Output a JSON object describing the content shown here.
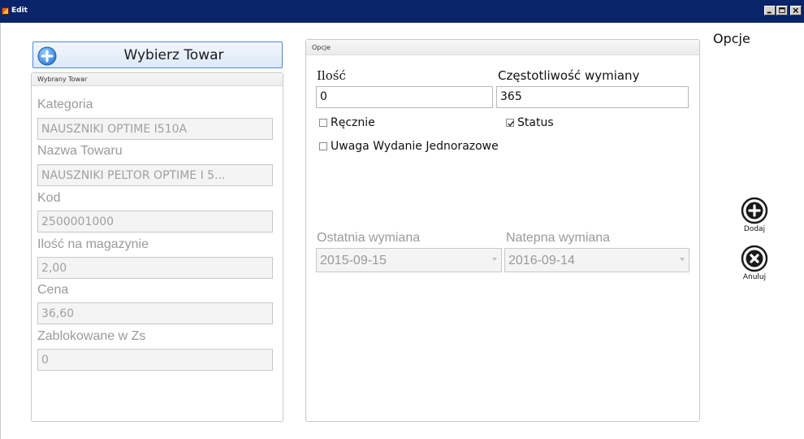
{
  "window": {
    "title": "Edit"
  },
  "left": {
    "select_button_label": "Wybierz Towar",
    "group_title": "Wybrany Towar",
    "fields": [
      {
        "label": "Kategoria",
        "value": "NAUSZNIKI OPTIME I510A"
      },
      {
        "label": "Nazwa Towaru",
        "value": "NAUSZNIKI PELTOR OPTIME I 5..."
      },
      {
        "label": "Kod",
        "value": "2500001000"
      },
      {
        "label": "Ilość na magazynie",
        "value": "2,00"
      },
      {
        "label": "Cena",
        "value": "36,60"
      },
      {
        "label": "Zablokowane w Zs",
        "value": "0"
      }
    ]
  },
  "options": {
    "group_title": "Opcje",
    "quantity": {
      "label": "Ilość",
      "value": "0"
    },
    "frequency": {
      "label": "Częstotliwość wymiany",
      "value": "365"
    },
    "checks": {
      "recznie": {
        "label": "Ręcznie",
        "checked": false
      },
      "status": {
        "label": "Status",
        "checked": true
      },
      "uwaga": {
        "label": "Uwaga Wydanie Jednorazowe",
        "checked": false
      }
    },
    "last_change": {
      "label": "Ostatnia wymiana",
      "value": "2015-09-15"
    },
    "next_change": {
      "label": "Natepna wymiana",
      "value": "2016-09-14"
    }
  },
  "actions": {
    "title": "Opcje",
    "add_label": "Dodaj",
    "cancel_label": "Anuluj"
  }
}
